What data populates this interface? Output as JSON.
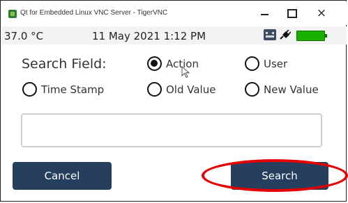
{
  "window": {
    "title": "Qt for Embedded Linux VNC Server - TigerVNC",
    "close_glyph": "×"
  },
  "status": {
    "temperature": "37.0 °C",
    "datetime": "11 May 2021 1:12 PM"
  },
  "form": {
    "search_field_label": "Search Field:",
    "options": [
      {
        "label": "Action",
        "checked": true
      },
      {
        "label": "User",
        "checked": false
      },
      {
        "label": "Time Stamp",
        "checked": false
      },
      {
        "label": "Old Value",
        "checked": false
      },
      {
        "label": "New Value",
        "checked": false
      }
    ],
    "search_input_value": ""
  },
  "buttons": {
    "cancel_label": "Cancel",
    "search_label": "Search"
  },
  "colors": {
    "button_bg": "#263f5e",
    "battery": "#19b000",
    "highlight": "#e60000"
  },
  "icons": [
    "app-icon",
    "minimize-icon",
    "maximize-icon",
    "close-icon",
    "keyboard-icon",
    "plug-icon",
    "battery-icon",
    "mouse-cursor-icon"
  ]
}
